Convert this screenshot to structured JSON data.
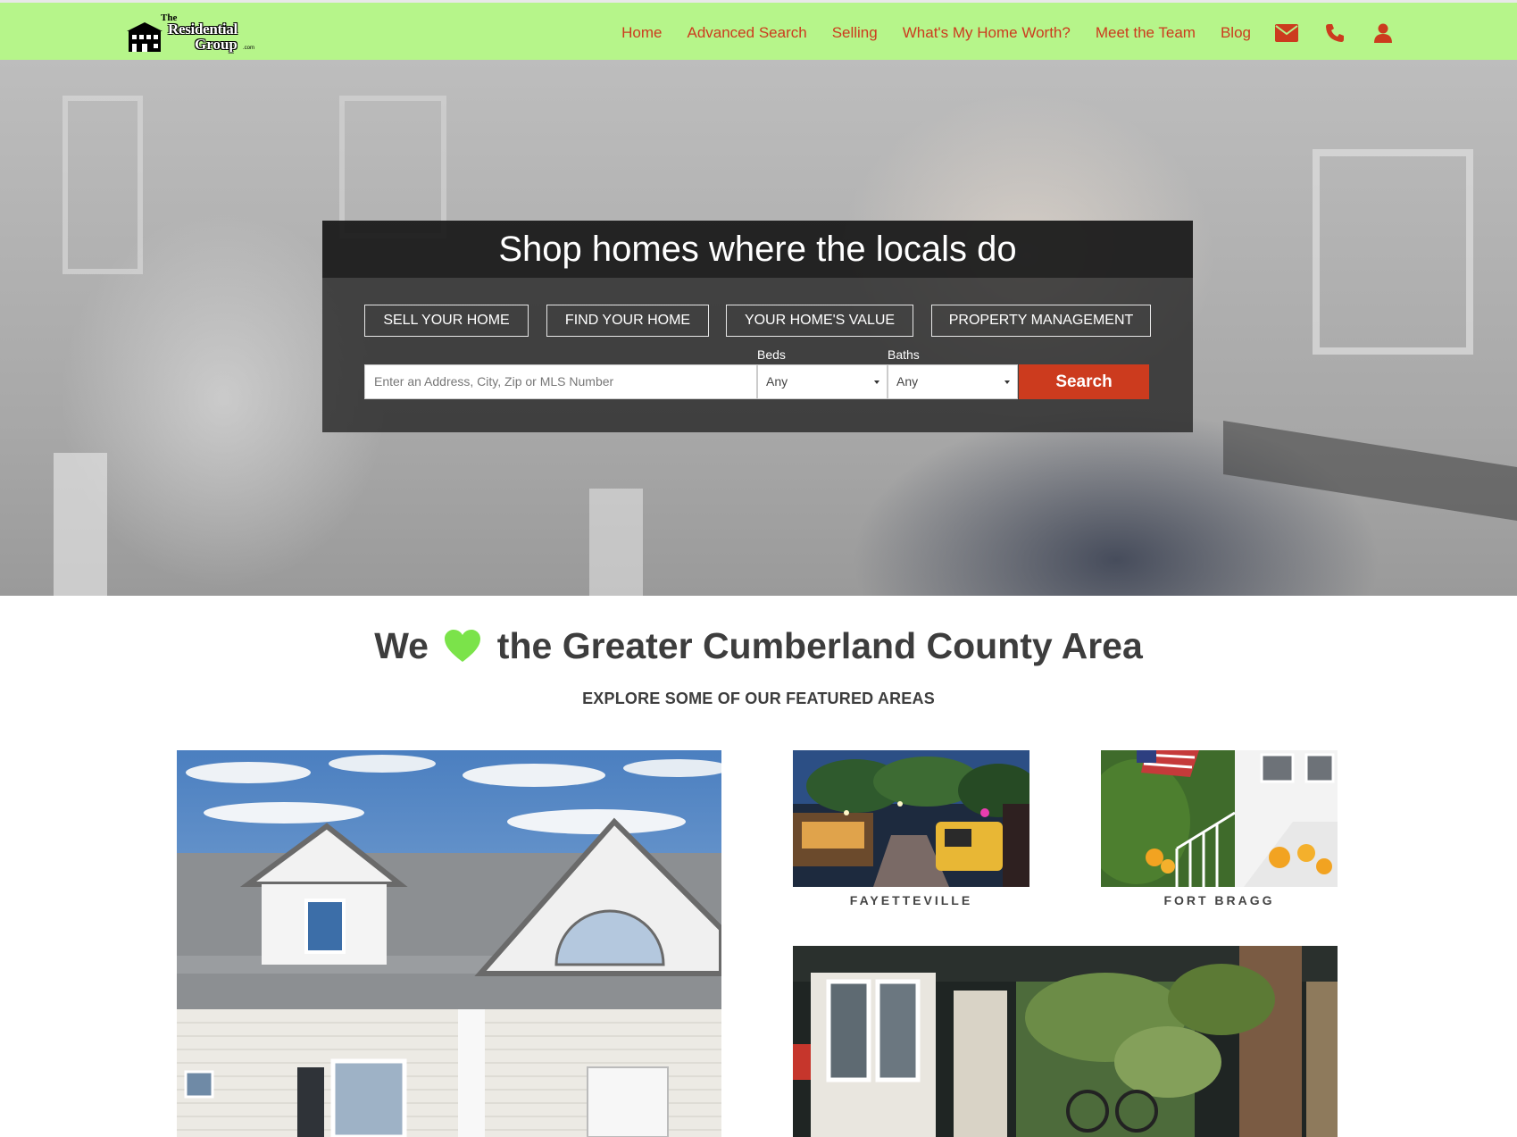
{
  "brand": {
    "logo_the": "The",
    "logo_main": "Residential",
    "logo_group": "Group",
    "logo_com": ".com"
  },
  "nav": {
    "items": [
      {
        "label": "Home"
      },
      {
        "label": "Advanced Search"
      },
      {
        "label": "Selling"
      },
      {
        "label": "What's My Home Worth?"
      },
      {
        "label": "Meet the Team"
      },
      {
        "label": "Blog"
      }
    ],
    "icons": [
      "envelope-icon",
      "phone-icon",
      "user-icon"
    ],
    "color": "#cc3b1e",
    "background": "#b6f58a"
  },
  "hero": {
    "title": "Shop homes where the locals do",
    "buttons": [
      {
        "label": "SELL YOUR HOME"
      },
      {
        "label": "FIND YOUR HOME"
      },
      {
        "label": "YOUR HOME'S VALUE"
      },
      {
        "label": "PROPERTY MANAGEMENT"
      }
    ],
    "search": {
      "placeholder": "Enter an Address, City, Zip or MLS Number",
      "beds_label": "Beds",
      "beds_value": "Any",
      "baths_label": "Baths",
      "baths_value": "Any",
      "button_label": "Search"
    }
  },
  "main": {
    "headline_before": "We",
    "headline_after": "the Greater Cumberland County Area",
    "heart_color": "#7be34a",
    "subheading": "EXPLORE SOME OF OUR FEATURED AREAS",
    "areas": [
      {
        "caption": "FAYETTEVILLE"
      },
      {
        "caption": "FORT BRAGG"
      }
    ]
  }
}
